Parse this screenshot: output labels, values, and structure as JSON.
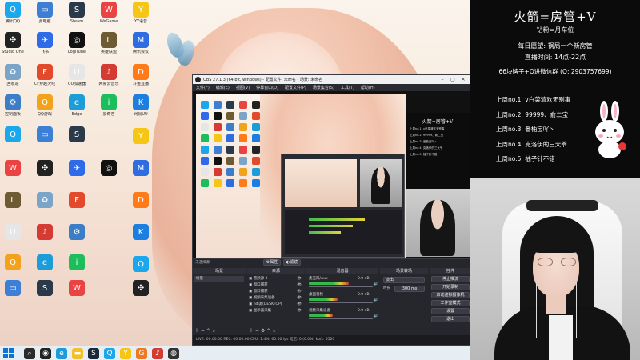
{
  "desktop": {
    "icons": [
      {
        "label": "腾讯QQ",
        "color": "#1aa7ec",
        "glyph": "Q"
      },
      {
        "label": "此电脑",
        "color": "#3d7fd6",
        "glyph": "▭"
      },
      {
        "label": "Steam",
        "color": "#2b3a4a",
        "glyph": "S"
      },
      {
        "label": "WeGame",
        "color": "#e94343",
        "glyph": "W"
      },
      {
        "label": "Studio One",
        "color": "#222222",
        "glyph": "✣"
      },
      {
        "label": "飞书",
        "color": "#2f6be8",
        "glyph": "✈"
      },
      {
        "label": "LogiTune",
        "color": "#111111",
        "glyph": "◎"
      },
      {
        "label": "英雄联盟",
        "color": "#6e5a33",
        "glyph": "L"
      },
      {
        "label": "回收站",
        "color": "#7aa4c8",
        "glyph": "♻"
      },
      {
        "label": "CF穿越火线",
        "color": "#e34a2b",
        "glyph": "F"
      },
      {
        "label": "UU加速器",
        "color": "#e6e6e6",
        "glyph": "U"
      },
      {
        "label": "网易云音乐",
        "color": "#d43c33",
        "glyph": "♪"
      },
      {
        "label": "控制面板",
        "color": "#3c7dc8",
        "glyph": "⚙"
      },
      {
        "label": "QQ游戏",
        "color": "#f3a21b",
        "glyph": "Q"
      },
      {
        "label": "Edge",
        "color": "#1c9dd9",
        "glyph": "e"
      },
      {
        "label": "爱奇艺",
        "color": "#1cbe5b",
        "glyph": "i"
      },
      {
        "label": "YY语音",
        "color": "#f6c616",
        "glyph": "Y"
      },
      {
        "label": "腾讯会议",
        "color": "#2e6ce0",
        "glyph": "M"
      },
      {
        "label": "斗鱼直播",
        "color": "#ff7a18",
        "glyph": "D"
      },
      {
        "label": "网易UU",
        "color": "#1b7ee0",
        "glyph": "K"
      }
    ],
    "taskbar_items": [
      {
        "name": "search",
        "color": "#2b2b2b",
        "glyph": "⌕"
      },
      {
        "name": "obs",
        "color": "#222222",
        "glyph": "◉"
      },
      {
        "name": "edge",
        "color": "#1c9dd9",
        "glyph": "e"
      },
      {
        "name": "explorer",
        "color": "#f3c02b",
        "glyph": "▬"
      },
      {
        "name": "steam",
        "color": "#1b2838",
        "glyph": "S"
      },
      {
        "name": "qq",
        "color": "#1aa7ec",
        "glyph": "Q"
      },
      {
        "name": "yy",
        "color": "#f6c616",
        "glyph": "Y"
      },
      {
        "name": "game",
        "color": "#f07a22",
        "glyph": "G"
      },
      {
        "name": "music",
        "color": "#d43c33",
        "glyph": "♪"
      },
      {
        "name": "app",
        "color": "#333333",
        "glyph": "◍"
      }
    ]
  },
  "obs": {
    "title": "OBS 27.1.3 (64 bit, windows) - 配置文件: 未命名 - 场景: 未命名",
    "menu": [
      "文件(F)",
      "编辑(E)",
      "视图(V)",
      "停靠窗口(D)",
      "配置文件(P)",
      "场景集合(S)",
      "工具(T)",
      "帮助(H)"
    ],
    "source_bar": {
      "label": "未选择源",
      "props": "属性",
      "filters": "滤镜"
    },
    "dock_headers": {
      "scenes": "场景",
      "sources": "来源",
      "mixer": "混音器",
      "transitions": "场景转场",
      "controls": "控件"
    },
    "scenes": [
      "场景"
    ],
    "sources": [
      "音频源 3",
      "窗口捕获",
      "窗口捕获",
      "视频采集设备",
      "ndi源(DESKTOP)",
      "显示器采集"
    ],
    "mixer": [
      {
        "name": "麦克风/Aux",
        "db": "0.0 dB",
        "level": 0.62
      },
      {
        "name": "桌面音频",
        "db": "0.0 dB",
        "level": 0.45
      },
      {
        "name": "视频采集设备",
        "db": "0.0 dB",
        "level": 0.38
      }
    ],
    "transition": {
      "type": "淡出",
      "duration_label": "时长",
      "duration": "300 ms"
    },
    "controls": [
      "停止推流",
      "开始录制",
      "启动虚拟摄像机",
      "工作室模式",
      "设置",
      "退出"
    ],
    "status": "LIVE: 00:00:00   REC: 00:00:00   CPU: 1.4%, 60.00 fps   延迟: 0 (0.0%)   kb/s: 5520"
  },
  "info_panel": {
    "title": "火箭=房管+V",
    "subtitle": "钻粉=月车位",
    "wish": "每日愿望: 祸局一个新房管",
    "time": "直播时间: 14点-22点",
    "qq": "66块牌子+Q进微信群 (Q: 2903757699)",
    "weeks": [
      "上周no.1: v白菜清欢无别事",
      "上周no.2: 99999、俞二宝",
      "上周no.3: 番柚宝吖丶",
      "上周no.4: 克洛伊的三大爷",
      "上周no.5: 柚子针不错"
    ]
  }
}
